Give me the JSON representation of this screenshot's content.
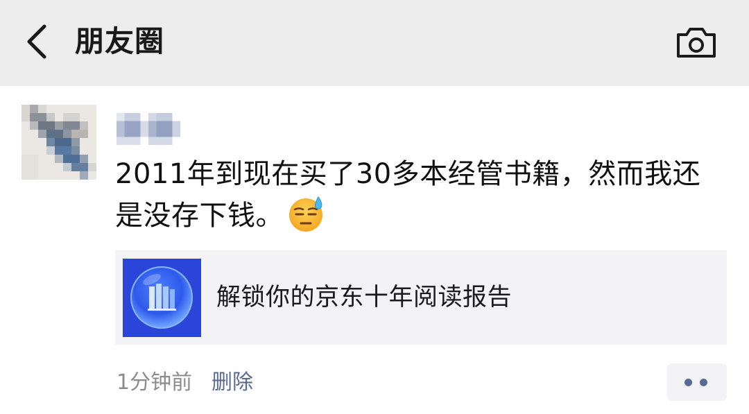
{
  "header": {
    "title": "朋友圈",
    "back_icon": "chevron-left-icon",
    "camera_icon": "camera-icon",
    "background": "#ededed"
  },
  "post": {
    "text": "2011年到现在买了30多本经管书籍，然而我还是没存下钱。",
    "emoji": "downcast-face-with-sweat-emoji",
    "link_card": {
      "title": "解锁你的京东十年阅读报告",
      "thumb_icon": "books-icon",
      "thumb_color": "#2a45d8"
    },
    "time": "1分钟前",
    "delete_label": "删除",
    "more_icon": "more-dots-icon"
  },
  "colors": {
    "link_blue": "#576b95",
    "muted_text": "#8c8c8c",
    "card_bg": "#f3f3f5"
  }
}
